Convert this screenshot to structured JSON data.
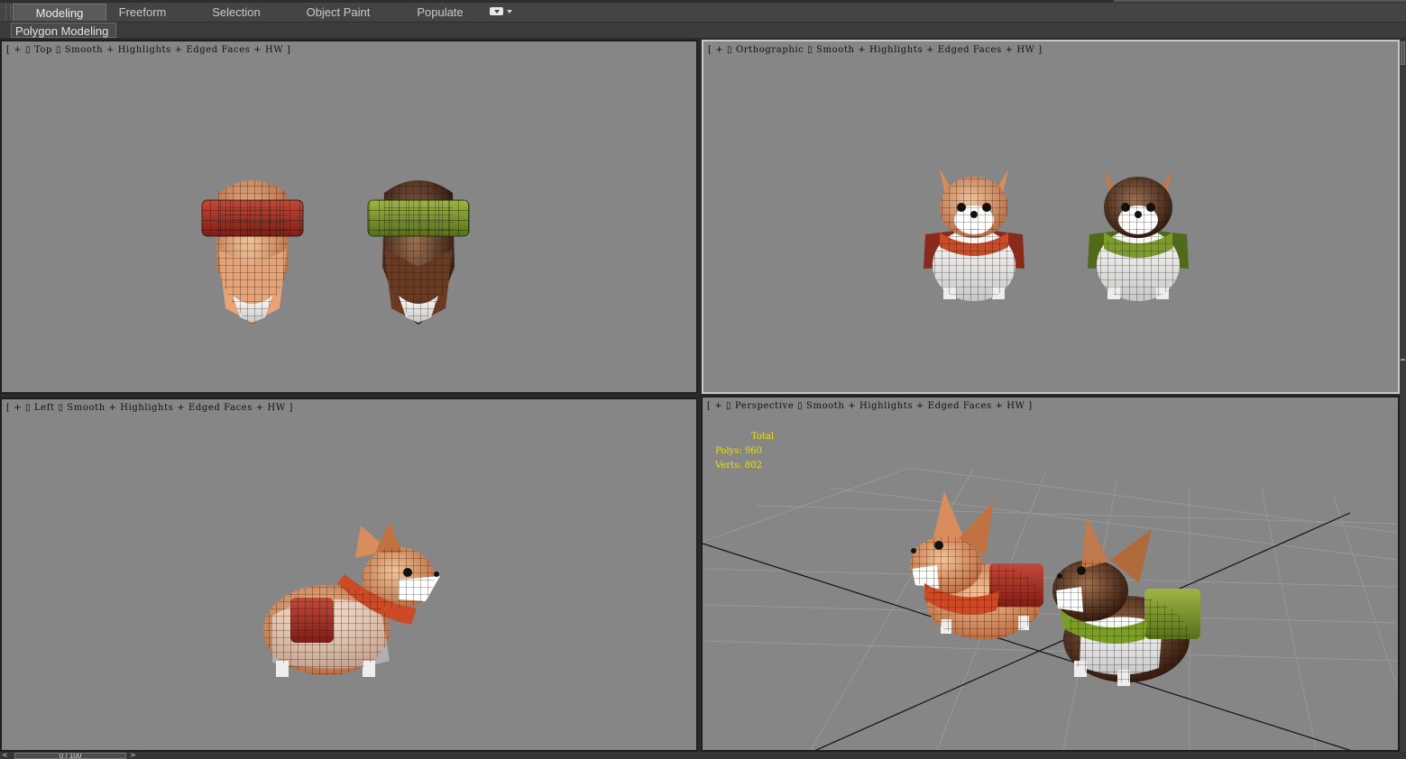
{
  "ribbon": {
    "tabs": [
      {
        "label": "Modeling",
        "active": true
      },
      {
        "label": "Freeform",
        "active": false
      },
      {
        "label": "Selection",
        "active": false
      },
      {
        "label": "Object Paint",
        "active": false
      },
      {
        "label": "Populate",
        "active": false
      }
    ],
    "panel_label": "Polygon Modeling"
  },
  "viewports": {
    "top": {
      "plus": "+",
      "name": "Top",
      "shading": "Smooth + Highlights + Edged Faces + HW"
    },
    "orthographic": {
      "plus": "+",
      "name": "Orthographic",
      "shading": "Smooth + Highlights + Edged Faces + HW"
    },
    "left": {
      "plus": "+",
      "name": "Left",
      "shading": "Smooth + Highlights + Edged Faces + HW"
    },
    "perspective": {
      "plus": "+",
      "name": "Perspective",
      "shading": "Smooth + Highlights + Edged Faces + HW",
      "stats": {
        "header": "Total",
        "polys_label": "Polys:",
        "polys": "960",
        "verts_label": "Verts:",
        "verts": "802"
      }
    }
  },
  "timeline": {
    "frame": "0 / 100",
    "prev": "<",
    "next": ">"
  },
  "colors": {
    "viewport_bg": "#868686",
    "ui_dark": "#444444",
    "stats_text": "#f0e000",
    "corgi_red_scarf": "#b8361e",
    "corgi_green_scarf": "#6c8a26",
    "corgi_fur_light": "#d99466",
    "corgi_fur_dark": "#4a2818"
  },
  "icons": [
    "grip-icon",
    "workspace-dropdown-icon",
    "viewport-plus-icon"
  ]
}
